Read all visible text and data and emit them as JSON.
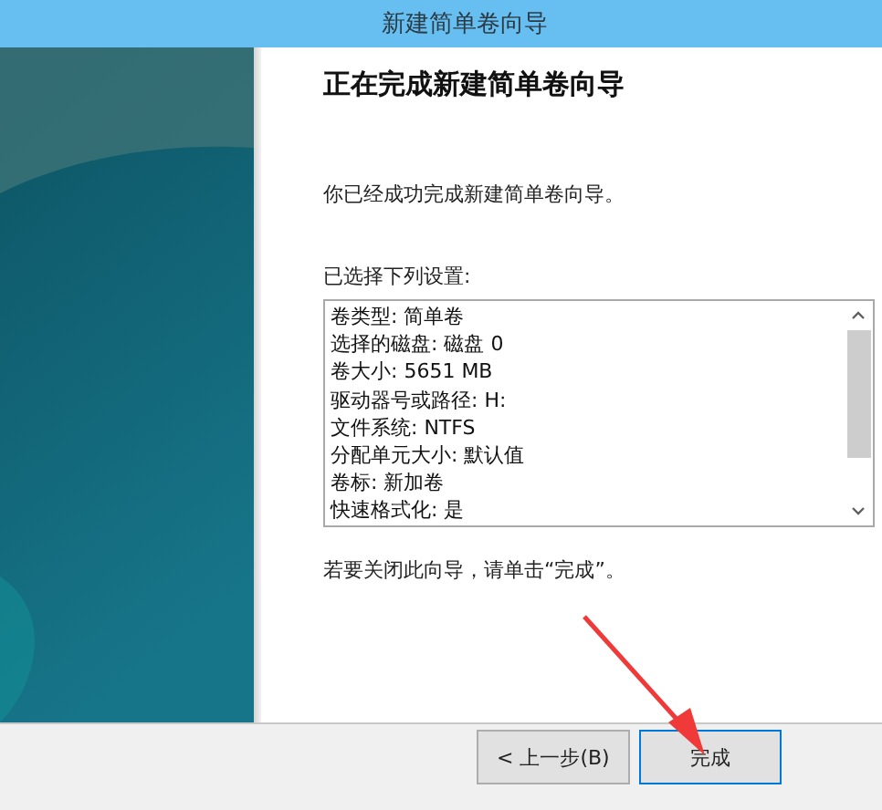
{
  "window": {
    "title": "新建简单卷向导"
  },
  "heading": "正在完成新建简单卷向导",
  "message": "你已经成功完成新建简单卷向导。",
  "settings_label": "已选择下列设置:",
  "settings": [
    "卷类型: 简单卷",
    "选择的磁盘: 磁盘 0",
    "卷大小: 5651 MB",
    "驱动器号或路径: H:",
    "文件系统: NTFS",
    "分配单元大小: 默认值",
    "卷标: 新加卷",
    "快速格式化: 是"
  ],
  "closing_hint": "若要关闭此向导，请单击“完成”。",
  "buttons": [
    {
      "label": "< 上一步(B)",
      "kind": "back"
    },
    {
      "label": "完成",
      "kind": "finish"
    }
  ]
}
